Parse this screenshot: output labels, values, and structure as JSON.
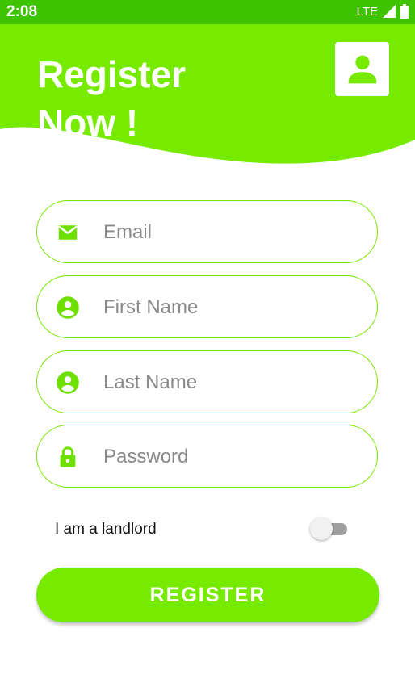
{
  "status_bar": {
    "time": "2:08",
    "network": "LTE"
  },
  "header": {
    "title_line1": "Register",
    "title_line2": "Now !"
  },
  "icons": {
    "profile": "account-box-icon",
    "email": "email-icon",
    "first_name": "account-circle-icon",
    "last_name": "account-circle-icon",
    "password": "lock-icon"
  },
  "form": {
    "email_placeholder": "Email",
    "first_name_placeholder": "First Name",
    "last_name_placeholder": "Last Name",
    "password_placeholder": "Password",
    "landlord_label": "I am a landlord",
    "landlord_enabled": false,
    "register_label": "REGISTER"
  },
  "colors": {
    "status_bar": "#3fc300",
    "brand_green": "#76eb00",
    "field_border": "#76e600",
    "icon_green": "#6ee000"
  }
}
